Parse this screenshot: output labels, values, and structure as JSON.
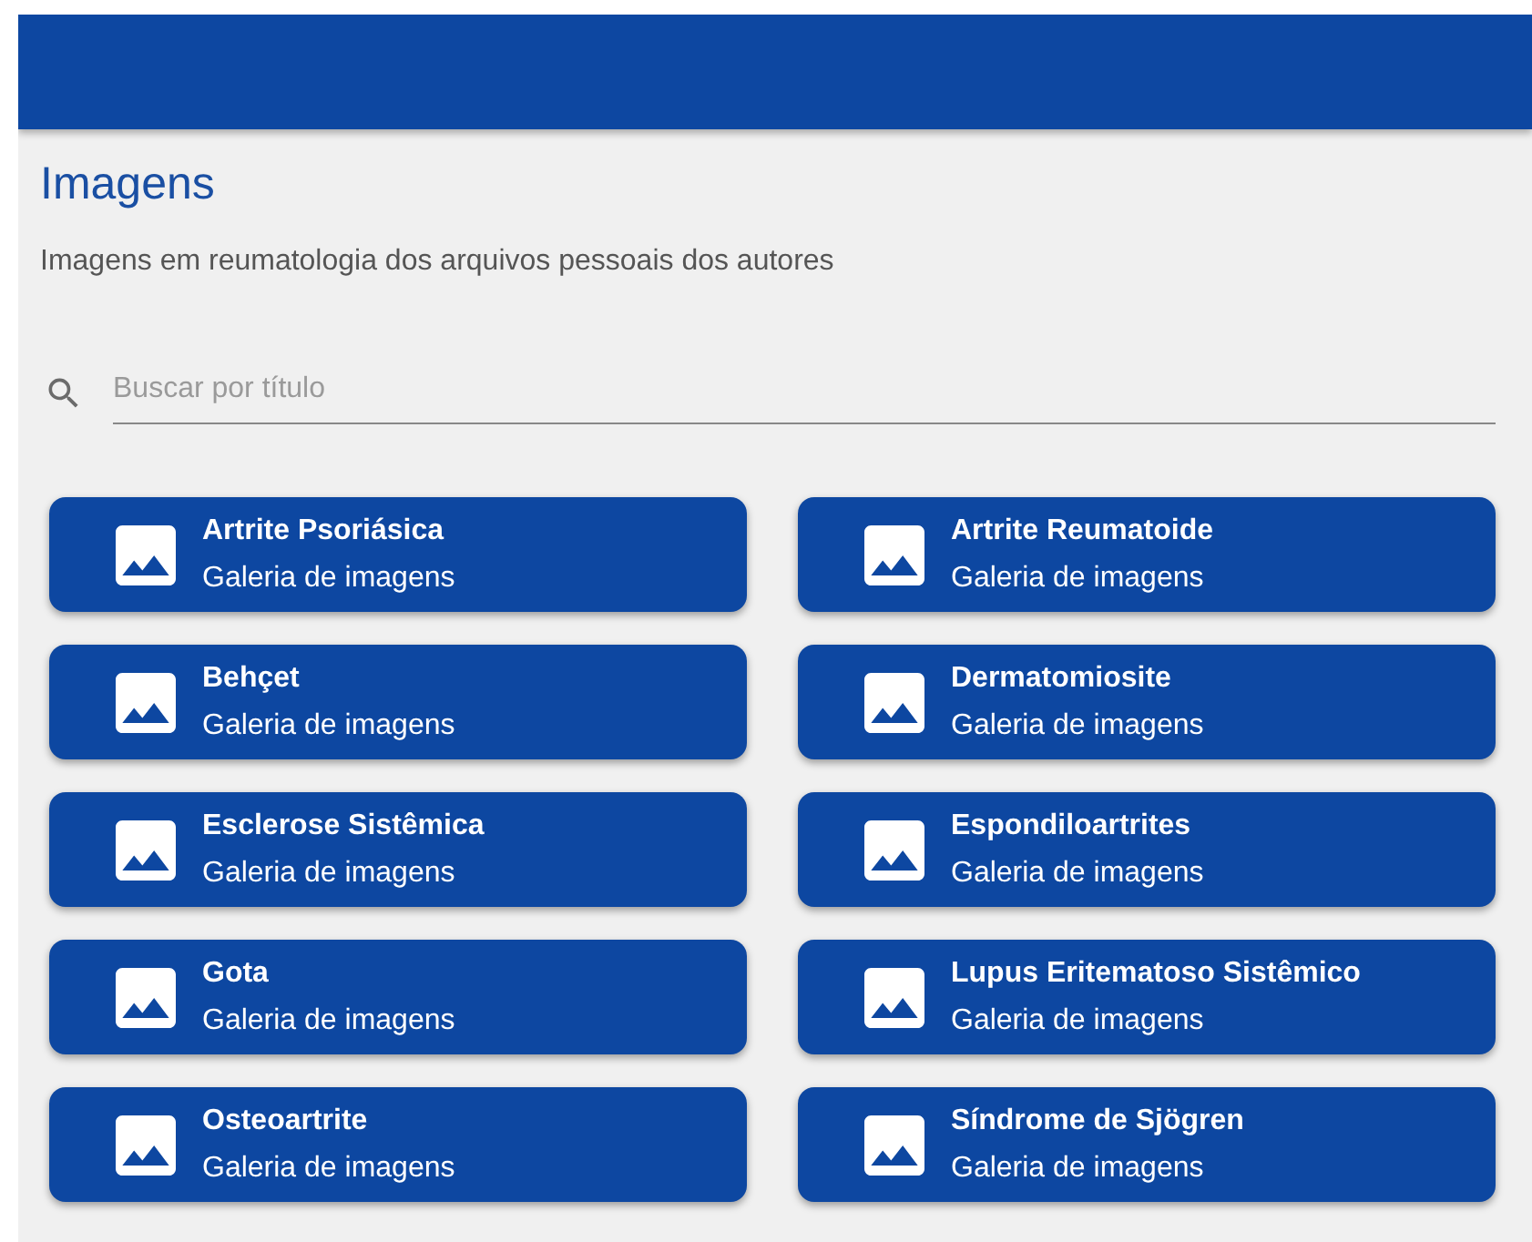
{
  "page": {
    "title": "Imagens",
    "subtitle": "Imagens em reumatologia dos arquivos pessoais dos autores"
  },
  "search": {
    "placeholder": "Buscar por título"
  },
  "galleries": [
    {
      "title": "Artrite Psoriásica",
      "subtitle": "Galeria de imagens"
    },
    {
      "title": "Artrite Reumatoide",
      "subtitle": "Galeria de imagens"
    },
    {
      "title": "Behçet",
      "subtitle": "Galeria de imagens"
    },
    {
      "title": "Dermatomiosite",
      "subtitle": "Galeria de imagens"
    },
    {
      "title": "Esclerose Sistêmica",
      "subtitle": "Galeria de imagens"
    },
    {
      "title": "Espondiloartrites",
      "subtitle": "Galeria de imagens"
    },
    {
      "title": "Gota",
      "subtitle": "Galeria de imagens"
    },
    {
      "title": "Lupus Eritematoso Sistêmico",
      "subtitle": "Galeria de imagens"
    },
    {
      "title": "Osteoartrite",
      "subtitle": "Galeria de imagens"
    },
    {
      "title": "Síndrome de Sjögren",
      "subtitle": "Galeria de imagens"
    }
  ]
}
